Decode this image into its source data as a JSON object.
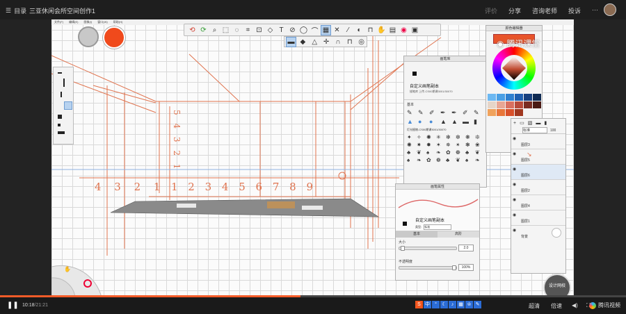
{
  "header": {
    "catalog": "目录",
    "title": "三亚休闲会所空间创作1",
    "actions": [
      "评价",
      "分享",
      "咨询老师",
      "投诉"
    ],
    "more": "···"
  },
  "app": {
    "menu": [
      "文件(F)",
      "编辑(E)",
      "图像(I)",
      "窗口(W)",
      "帮助(H)"
    ],
    "primary_color": "#f04a1c",
    "secondary_color": "#c8c8c8"
  },
  "sketch": {
    "numbers": "5 4 3 2 1",
    "left_scale": "4 3 2 1",
    "right_scale": "1 2 3 4 5 6 7 8 9"
  },
  "brush_library": {
    "title": "画笔库",
    "brush_name": "自定义画笔副本",
    "brush_sub": "描笔库  上传-CS00期课3001/30070",
    "section_basic": "基本",
    "section_light": "灯光植物-CS00期课3001/30070"
  },
  "brush_props": {
    "title": "画笔属性",
    "brush_name": "自定义画笔副本",
    "type_label": "类型:",
    "type_value": "标准",
    "tabs": [
      "基本",
      "高阶"
    ],
    "size_label": "大小",
    "size_value": "2.0",
    "opacity_label": "不透明度",
    "opacity_value": "100%"
  },
  "color_editor": {
    "title": "颜色编辑器",
    "swatches": [
      "#6cb8f2",
      "#4a9fe5",
      "#2f80d0",
      "#1f5fb0",
      "#163f7e",
      "#0f2a52",
      "#e6d5c8",
      "#e8a694",
      "#d97060",
      "#b84a3a",
      "#7a2c22",
      "#4a1a14",
      "#f0a25c",
      "#e8763a",
      "#d8502a",
      "#a03820"
    ]
  },
  "layers": {
    "blend": "标准",
    "opacity": "100",
    "items": [
      "图层3",
      "图层5",
      "图层6",
      "图层2",
      "图层4",
      "图层1",
      "背景"
    ]
  },
  "watermark": "腾讯课堂",
  "badge": "设计网校",
  "player": {
    "time_current": "10:18",
    "time_total": "/21:21",
    "progress": 0.48,
    "quality": "超清",
    "speed": "倍速",
    "brand": "腾讯视频"
  }
}
